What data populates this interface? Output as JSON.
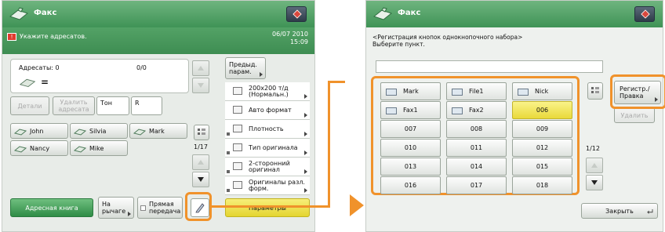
{
  "left_screen": {
    "title": "Факс",
    "warning": "Укажите адресатов.",
    "date": "06/07 2010",
    "time": "15:09",
    "recipients_label": "Адресаты: 0",
    "recipients_count": "0/0",
    "destination_value": "=",
    "details_btn": "Детали",
    "delete_addr_btn": "Удалить адресата",
    "tone_btn": "Тон",
    "r_btn": "R",
    "addresses": [
      "John",
      "Silvia",
      "Mark",
      "Nancy",
      "Mike"
    ],
    "page_indicator": "1/17",
    "prev_settings_btn": "Предыд. парам.",
    "settings": [
      {
        "label": "200x200 т/д (Нормальн.)",
        "icon": "resolution-icon"
      },
      {
        "label": "Авто формат",
        "icon": "auto-size-icon"
      },
      {
        "label": "Плотность",
        "icon": "density-icon"
      },
      {
        "label": "Тип оригинала",
        "icon": "original-type-icon"
      },
      {
        "label": "2-сторонний оригинал",
        "icon": "two-sided-icon"
      },
      {
        "label": "Оригиналы разл. форм.",
        "icon": "mixed-originals-icon"
      }
    ],
    "address_book_btn": "Адресная книга",
    "on_hook_btn": "На рычаге",
    "direct_send_btn": "Прямая передача",
    "options_btn": "Параметры"
  },
  "right_screen": {
    "title": "Факс",
    "instruction_line1": "<Регистрация кнопок однокнопочного набора>",
    "instruction_line2": "Выберите пункт.",
    "search_value": "",
    "buttons": [
      {
        "label": "Mark",
        "type": "named"
      },
      {
        "label": "File1",
        "type": "named"
      },
      {
        "label": "Nick",
        "type": "named"
      },
      {
        "label": "Fax1",
        "type": "named"
      },
      {
        "label": "Fax2",
        "type": "named"
      },
      {
        "label": "006",
        "type": "selected"
      },
      {
        "label": "007",
        "type": "number"
      },
      {
        "label": "008",
        "type": "number"
      },
      {
        "label": "009",
        "type": "number"
      },
      {
        "label": "010",
        "type": "number"
      },
      {
        "label": "011",
        "type": "number"
      },
      {
        "label": "012",
        "type": "number"
      },
      {
        "label": "013",
        "type": "number"
      },
      {
        "label": "014",
        "type": "number"
      },
      {
        "label": "015",
        "type": "number"
      },
      {
        "label": "016",
        "type": "number"
      },
      {
        "label": "017",
        "type": "number"
      },
      {
        "label": "018",
        "type": "number"
      }
    ],
    "page_indicator": "1/12",
    "register_edit_btn": "Регистр./ Правка",
    "delete_btn": "Удалить",
    "close_btn": "Закрыть"
  },
  "colors": {
    "title_green": "#3f9356",
    "accent_orange": "#f0922b",
    "selected_yellow": "#e9d93a"
  }
}
